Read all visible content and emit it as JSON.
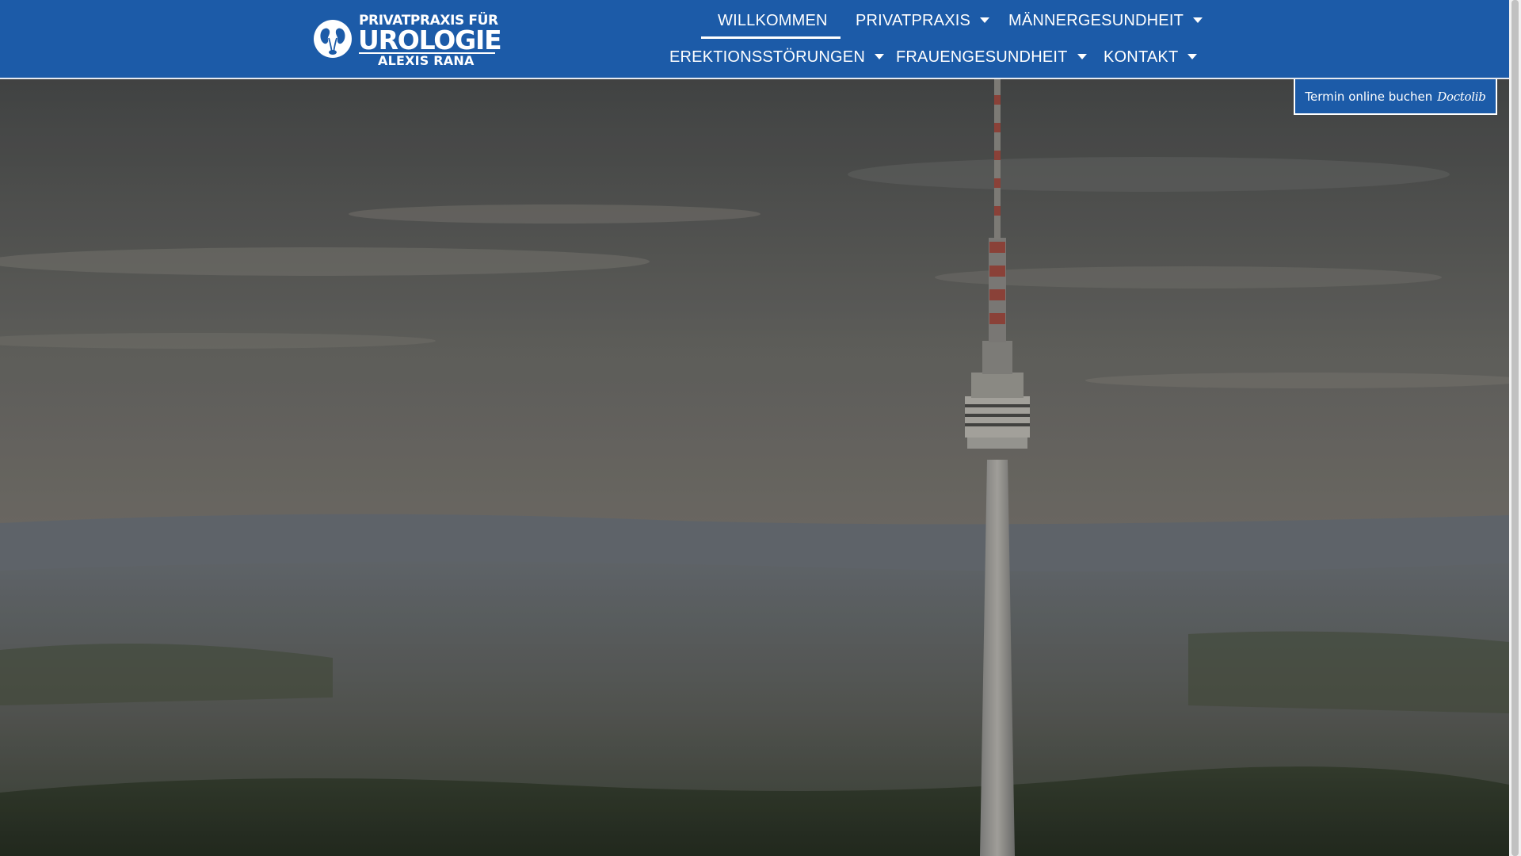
{
  "logo": {
    "line1": "PRIVATPRAXIS FÜR",
    "line2": "UROLOGIE",
    "line3": "ALEXIS RANA",
    "mark_icon": "kidney-icon"
  },
  "nav": {
    "items": [
      {
        "label": "WILLKOMMEN",
        "has_dropdown": false,
        "active": true
      },
      {
        "label": "PRIVATPRAXIS",
        "has_dropdown": true
      },
      {
        "label": "MÄNNERGESUNDHEIT",
        "has_dropdown": true
      },
      {
        "label": "EREKTIONSSTÖRUNGEN",
        "has_dropdown": true
      },
      {
        "label": "FRAUENGESUNDHEIT",
        "has_dropdown": true
      },
      {
        "label": "KONTAKT",
        "has_dropdown": true
      }
    ]
  },
  "booking": {
    "label": "Termin online buchen",
    "brand": "Doctolib"
  },
  "hero": {
    "image": "stuttgart-tv-tower-aerial-photo"
  },
  "colors": {
    "header_bg": "#1c5ba8",
    "text": "#ffffff"
  }
}
